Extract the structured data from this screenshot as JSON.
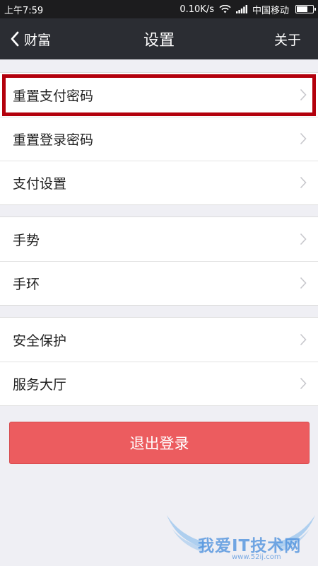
{
  "status_bar": {
    "time": "上午7:59",
    "speed": "0.10K/s",
    "carrier": "中国移动"
  },
  "nav": {
    "back_label": "财富",
    "title": "设置",
    "about_label": "关于"
  },
  "groups": [
    {
      "items": [
        {
          "label": "重置支付密码",
          "highlighted": true
        },
        {
          "label": "重置登录密码"
        },
        {
          "label": "支付设置"
        }
      ]
    },
    {
      "items": [
        {
          "label": "手势"
        },
        {
          "label": "手环"
        }
      ]
    },
    {
      "items": [
        {
          "label": "安全保护"
        },
        {
          "label": "服务大厅"
        }
      ]
    }
  ],
  "logout_label": "退出登录",
  "watermark": {
    "text": "我爱IT技术网",
    "url": "www.52ij.com"
  },
  "colors": {
    "nav_bg": "#2b2d33",
    "page_bg": "#efeff4",
    "logout_bg": "#ec5c5f",
    "highlight": "#b3000c"
  }
}
